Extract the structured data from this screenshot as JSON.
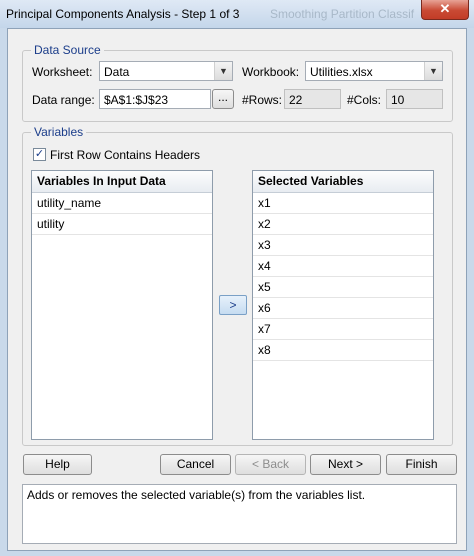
{
  "window": {
    "title": "Principal Components Analysis - Step 1 of 3",
    "background_title": "Smoothing   Partition  Classif",
    "close_glyph": "✕"
  },
  "data_source": {
    "legend": "Data Source",
    "worksheet_label": "Worksheet:",
    "worksheet_value": "Data",
    "workbook_label": "Workbook:",
    "workbook_value": "Utilities.xlsx",
    "range_label": "Data range:",
    "range_value": "$A$1:$J$23",
    "range_button": "...",
    "rows_label": "#Rows:",
    "rows_value": "22",
    "cols_label": "#Cols:",
    "cols_value": "10"
  },
  "variables": {
    "legend": "Variables",
    "first_row_headers_label": "First Row Contains Headers",
    "first_row_headers_checked": true,
    "input_header": "Variables In Input Data",
    "input_items": [
      "utility_name",
      "utility"
    ],
    "selected_header": "Selected Variables",
    "selected_items": [
      "x1",
      "x2",
      "x3",
      "x4",
      "x5",
      "x6",
      "x7",
      "x8"
    ],
    "move_button": ">"
  },
  "buttons": {
    "help": "Help",
    "cancel": "Cancel",
    "back": "< Back",
    "next": "Next >",
    "finish": "Finish"
  },
  "help_text": "Adds or removes the selected variable(s) from the variables list.",
  "colors": {
    "accent": "#1b3d8a",
    "close": "#c94a34"
  }
}
